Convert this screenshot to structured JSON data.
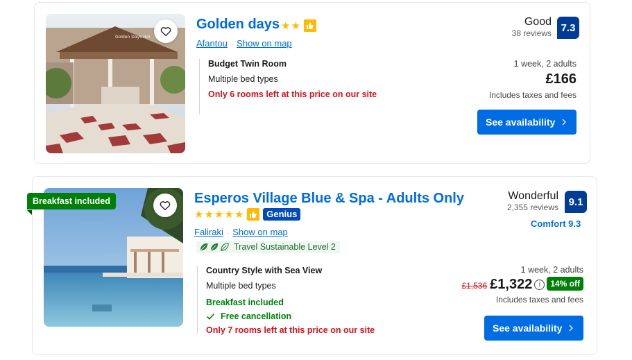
{
  "listings": [
    {
      "name": "Golden days",
      "star_count": 2,
      "location": "Afantou",
      "map_link": "Show on map",
      "room_name": "Budget Twin Room",
      "beds": "Multiple bed types",
      "scarcity": "Only 6 rooms left at this price on our site",
      "review_word": "Good",
      "review_count": "38 reviews",
      "score": "7.3",
      "nights": "1 week, 2 adults",
      "price": "£166",
      "taxes": "Includes taxes and fees",
      "button": "See availability",
      "photo_sign": "Golden Days Hot"
    },
    {
      "name": "Esperos Village Blue & Spa - Adults Only",
      "star_count": 5,
      "genius": "Genius",
      "ribbon": "Breakfast included",
      "location": "Faliraki",
      "map_link": "Show on map",
      "sustainable": "Travel Sustainable Level 2",
      "room_name": "Country Style with Sea View",
      "beds": "Multiple bed types",
      "breakfast": "Breakfast included",
      "cancellation": "Free cancellation",
      "scarcity": "Only 7 rooms left at this price on our site",
      "review_word": "Wonderful",
      "review_count": "2,355 reviews",
      "score": "9.1",
      "comfort": "Comfort 9.3",
      "nights": "1 week, 2 adults",
      "old_price": "£1,536",
      "price": "£1,322",
      "discount": "14% off",
      "taxes": "Includes taxes and fees",
      "button": "See availability"
    }
  ],
  "colors": {
    "link_blue": "#006ce4",
    "score_blue": "#003b95",
    "star_yellow": "#febb02",
    "green": "#008009",
    "red": "#d4111e"
  },
  "icons": [
    "heart-icon",
    "star-icon",
    "thumbs-up-icon",
    "leaf-icon",
    "check-icon",
    "info-icon",
    "chevron-right-icon"
  ]
}
